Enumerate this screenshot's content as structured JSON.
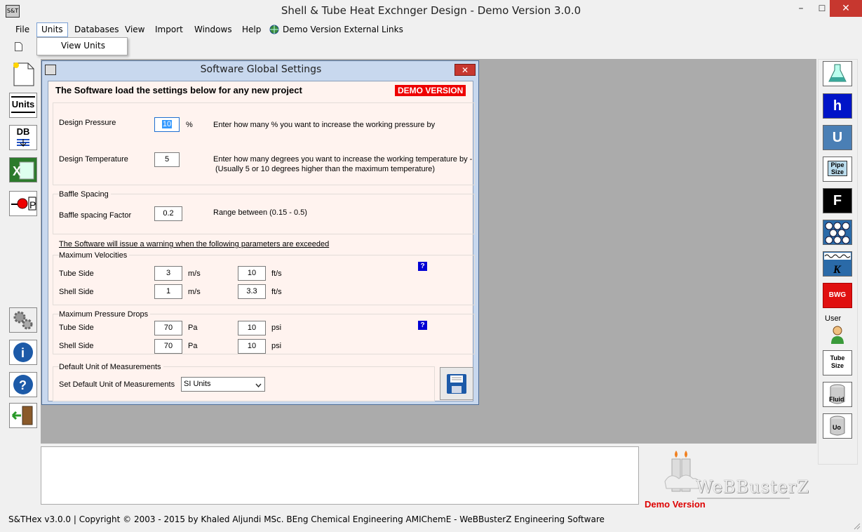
{
  "window": {
    "title": "Shell & Tube Heat Exchnger Design - Demo Version 3.0.0",
    "icon_text": "S&T",
    "minimize": "–",
    "maximize": "☐",
    "close": "✕"
  },
  "menu": {
    "items": [
      "File",
      "Units",
      "Databases",
      "View",
      "Import",
      "Windows",
      "Help",
      "Demo Version External Links"
    ],
    "units_dropdown": [
      "View Units"
    ]
  },
  "left_toolbar": [
    {
      "name": "new-project-icon"
    },
    {
      "name": "units-icon",
      "label": "Units"
    },
    {
      "name": "database-icon",
      "label": "DB"
    },
    {
      "name": "excel-icon"
    },
    {
      "name": "pump-pressure-icon",
      "label": "P"
    },
    {
      "name": "settings-gears-icon"
    },
    {
      "name": "info-icon",
      "label": "i"
    },
    {
      "name": "help-icon",
      "label": "?"
    },
    {
      "name": "exit-door-icon"
    }
  ],
  "right_toolbar": {
    "buttons": [
      {
        "name": "flask-icon",
        "label": ""
      },
      {
        "name": "h-coefficient-icon",
        "label": "h"
      },
      {
        "name": "u-coefficient-icon",
        "label": "U"
      },
      {
        "name": "pipe-size-icon",
        "label": "Pipe Size"
      },
      {
        "name": "fouling-icon",
        "label": "F"
      },
      {
        "name": "tube-layout-icon",
        "label": ""
      },
      {
        "name": "conductivity-icon",
        "label": "K"
      },
      {
        "name": "bwg-icon",
        "label": "BWG"
      }
    ],
    "user_label": "User",
    "user_buttons": [
      {
        "name": "tube-size-db-icon",
        "label": "Tube Size"
      },
      {
        "name": "fluid-db-icon",
        "label": "Fluid"
      },
      {
        "name": "uo-db-icon",
        "label": "Uo"
      }
    ]
  },
  "dialog": {
    "title": "Software Global Settings",
    "close": "✕",
    "header": "The Software load the settings below for any new project",
    "demo_badge": "DEMO VERSION",
    "design_pressure": {
      "label": "Design Pressure",
      "value": "10",
      "unit": "%",
      "hint": "Enter how many % you want to increase the working pressure by"
    },
    "design_temperature": {
      "label": "Design Temperature",
      "value": "5",
      "hint_line1": "Enter how many degrees you want to increase the working temperature by -",
      "hint_line2": "(Usually 5 or 10 degrees higher than the maximum temperature)"
    },
    "baffle": {
      "group_label": "Baffle Spacing",
      "label": "Baffle spacing Factor",
      "value": "0.2",
      "hint": "Range between (0.15 - 0.5)"
    },
    "warning_text": "The Software will issue a warning when the following parameters are exceeded",
    "velocities": {
      "group_label": "Maximum Velocities",
      "tube_label": "Tube Side",
      "tube_si": "3",
      "tube_si_unit": "m/s",
      "tube_us": "10",
      "tube_us_unit": "ft/s",
      "shell_label": "Shell Side",
      "shell_si": "1",
      "shell_si_unit": "m/s",
      "shell_us": "3.3",
      "shell_us_unit": "ft/s",
      "help": "?"
    },
    "pressure_drops": {
      "group_label": "Maximum Pressure Drops",
      "tube_label": "Tube Side",
      "tube_si": "70",
      "tube_si_unit": "Pa",
      "tube_us": "10",
      "tube_us_unit": "psi",
      "shell_label": "Shell Side",
      "shell_si": "70",
      "shell_si_unit": "Pa",
      "shell_us": "10",
      "shell_us_unit": "psi",
      "help": "?"
    },
    "default_units": {
      "group_label": "Default Unit of Measurements",
      "label": "Set Default Unit of Measurements",
      "selected": "SI Units"
    }
  },
  "branding": {
    "logo_text": "WeBBusterZ",
    "demo_text": "Demo Version"
  },
  "status": {
    "text": "S&THex  v3.0.0  |  Copyright © 2003 - 2015 by Khaled Aljundi MSc. BEng Chemical Engineering AMIChemE - WeBBusterZ Engineering Software"
  },
  "colors": {
    "accent_red": "#e00000",
    "blue_button": "#0014c8",
    "steel_button": "#4a7fb5",
    "dialog_bg": "#fff3ef"
  }
}
